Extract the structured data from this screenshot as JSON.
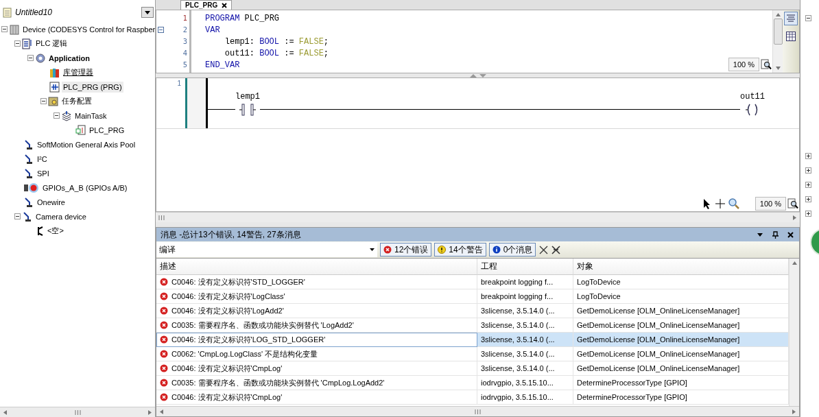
{
  "project": {
    "title": "Untitled10"
  },
  "tree": [
    {
      "label": "Device (CODESYS Control for Raspber",
      "kind": "device",
      "expanded": true,
      "active": false,
      "selected": false,
      "children": [
        {
          "label": "PLC 逻辑",
          "kind": "plc",
          "expanded": true,
          "active": false,
          "selected": false,
          "children": [
            {
              "label": "Application",
              "kind": "application",
              "expanded": true,
              "active": true,
              "selected": false,
              "children": [
                {
                  "label": "库管理器",
                  "kind": "library",
                  "active": false,
                  "selected": false
                },
                {
                  "label": "PLC_PRG (PRG)",
                  "kind": "pou",
                  "active": false,
                  "selected": true
                },
                {
                  "label": "任务配置",
                  "kind": "taskconfig",
                  "expanded": true,
                  "active": false,
                  "selected": false,
                  "children": [
                    {
                      "label": "MainTask",
                      "kind": "task",
                      "expanded": true,
                      "active": false,
                      "selected": false,
                      "children": [
                        {
                          "label": "PLC_PRG",
                          "kind": "taskcall",
                          "active": false,
                          "selected": false
                        }
                      ]
                    }
                  ]
                }
              ]
            }
          ]
        },
        {
          "label": "SoftMotion General Axis Pool",
          "kind": "axis",
          "active": false,
          "selected": false
        },
        {
          "label": "I²C",
          "kind": "axis",
          "active": false,
          "selected": false
        },
        {
          "label": "SPI",
          "kind": "axis",
          "active": false,
          "selected": false
        },
        {
          "label": "GPIOs_A_B (GPIOs A/B)",
          "kind": "gpio",
          "active": false,
          "selected": false
        },
        {
          "label": "Onewire",
          "kind": "axis",
          "active": false,
          "selected": false
        },
        {
          "label": "Camera device",
          "kind": "axis",
          "expanded": true,
          "active": false,
          "selected": false,
          "children": [
            {
              "label": "<空>",
              "kind": "empty",
              "active": false,
              "selected": false
            }
          ]
        }
      ]
    }
  ],
  "editor_tab": {
    "label": "PLC_PRG"
  },
  "declaration": {
    "zoom": "100 %",
    "lines": [
      {
        "number": "1",
        "current": true,
        "fold_marker": false,
        "tokens": [
          {
            "text": "PROGRAM",
            "kind": "keyword"
          },
          {
            "text": " PLC_PRG",
            "kind": "ident"
          }
        ]
      },
      {
        "number": "2",
        "current": false,
        "fold_marker": true,
        "tokens": [
          {
            "text": "VAR",
            "kind": "keyword"
          }
        ]
      },
      {
        "number": "3",
        "current": false,
        "fold_marker": false,
        "tokens": [
          {
            "text": "    lemp1: ",
            "kind": "ident"
          },
          {
            "text": "BOOL",
            "kind": "keyword"
          },
          {
            "text": " := ",
            "kind": "ident"
          },
          {
            "text": "FALSE",
            "kind": "literal"
          },
          {
            "text": ";",
            "kind": "ident"
          }
        ]
      },
      {
        "number": "4",
        "current": false,
        "fold_marker": false,
        "tokens": [
          {
            "text": "    out11: ",
            "kind": "ident"
          },
          {
            "text": "BOOL",
            "kind": "keyword"
          },
          {
            "text": " := ",
            "kind": "ident"
          },
          {
            "text": "FALSE",
            "kind": "literal"
          },
          {
            "text": ";",
            "kind": "ident"
          }
        ]
      },
      {
        "number": "5",
        "current": false,
        "fold_marker": false,
        "tokens": [
          {
            "text": "END_VAR",
            "kind": "keyword"
          }
        ]
      }
    ]
  },
  "ladder": {
    "zoom": "100 %",
    "networks": [
      {
        "number": "1",
        "contact": "lemp1",
        "coil": "out11"
      }
    ]
  },
  "messages": {
    "title": "消息 -总计13个错误, 14警告, 27条消息",
    "category": "编译",
    "filters": [
      {
        "kind": "error",
        "label": "12个错误",
        "selected": true
      },
      {
        "kind": "warning",
        "label": "14个警告",
        "selected": true
      },
      {
        "kind": "info",
        "label": "0个消息",
        "selected": true
      }
    ],
    "columns": [
      "描述",
      "工程",
      "对象"
    ],
    "rows": [
      {
        "kind": "error",
        "selected": false,
        "description": "C0046: 没有定义标识符'STD_LOGGER'",
        "project": "breakpoint logging f...",
        "object": "LogToDevice"
      },
      {
        "kind": "error",
        "selected": false,
        "description": "C0046: 没有定义标识符'LogClass'",
        "project": "breakpoint logging f...",
        "object": "LogToDevice"
      },
      {
        "kind": "error",
        "selected": false,
        "description": "C0046: 没有定义标识符'LogAdd2'",
        "project": "3slicense, 3.5.14.0 (...",
        "object": "GetDemoLicense [OLM_OnlineLicenseManager]"
      },
      {
        "kind": "error",
        "selected": false,
        "description": "C0035: 需要程序名、函数或功能块实例替代 'LogAdd2'",
        "project": "3slicense, 3.5.14.0 (...",
        "object": "GetDemoLicense [OLM_OnlineLicenseManager]"
      },
      {
        "kind": "error",
        "selected": true,
        "description": "C0046: 没有定义标识符'LOG_STD_LOGGER'",
        "project": "3slicense, 3.5.14.0 (...",
        "object": "GetDemoLicense [OLM_OnlineLicenseManager]"
      },
      {
        "kind": "error",
        "selected": false,
        "description": "C0062: 'CmpLog.LogClass' 不是结构化变量",
        "project": "3slicense, 3.5.14.0 (...",
        "object": "GetDemoLicense [OLM_OnlineLicenseManager]"
      },
      {
        "kind": "error",
        "selected": false,
        "description": "C0046: 没有定义标识符'CmpLog'",
        "project": "3slicense, 3.5.14.0 (...",
        "object": "GetDemoLicense [OLM_OnlineLicenseManager]"
      },
      {
        "kind": "error",
        "selected": false,
        "description": "C0035: 需要程序名、函数或功能块实例替代 'CmpLog.LogAdd2'",
        "project": "iodrvgpio, 3.5.15.10...",
        "object": "DetermineProcessorType [GPIO]"
      },
      {
        "kind": "error",
        "selected": false,
        "description": "C0046: 没有定义标识符'CmpLog'",
        "project": "iodrvgpio, 3.5.15.10...",
        "object": "DetermineProcessorType [GPIO]"
      }
    ]
  },
  "side_panel": {
    "groups": [
      {
        "expanded": true
      },
      {
        "expanded": false
      },
      {
        "expanded": false
      },
      {
        "expanded": false
      },
      {
        "expanded": false
      },
      {
        "expanded": false
      }
    ]
  }
}
